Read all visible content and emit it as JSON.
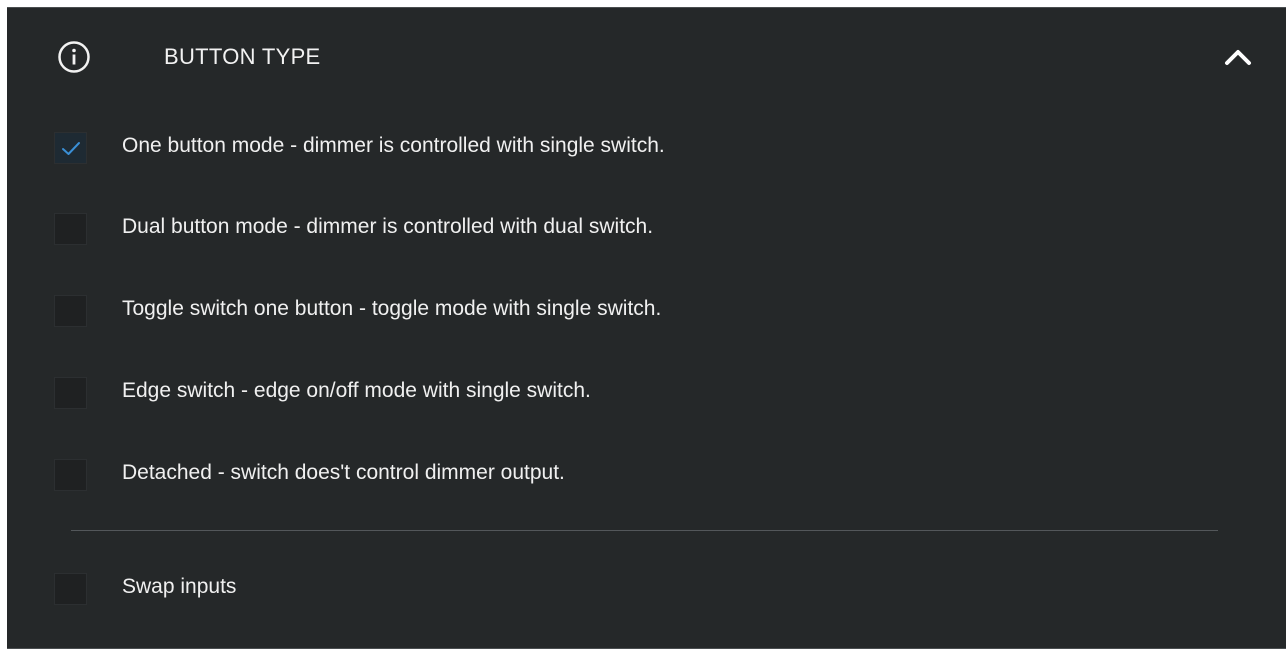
{
  "section": {
    "title": "BUTTON TYPE",
    "info_icon": "info-icon",
    "collapse_icon": "chevron-up-icon"
  },
  "options": [
    {
      "label": "One button mode - dimmer is controlled with single switch.",
      "checked": true
    },
    {
      "label": "Dual button mode - dimmer is controlled with dual switch.",
      "checked": false
    },
    {
      "label": "Toggle switch one button - toggle mode with single switch.",
      "checked": false
    },
    {
      "label": "Edge switch - edge on/off mode with single switch.",
      "checked": false
    },
    {
      "label": "Detached - switch does't control dimmer output.",
      "checked": false
    }
  ],
  "swap": {
    "label": "Swap inputs",
    "checked": false
  },
  "colors": {
    "panel_bg": "#252829",
    "check_accent": "#3a8fd6",
    "text": "#f0f0f0"
  }
}
